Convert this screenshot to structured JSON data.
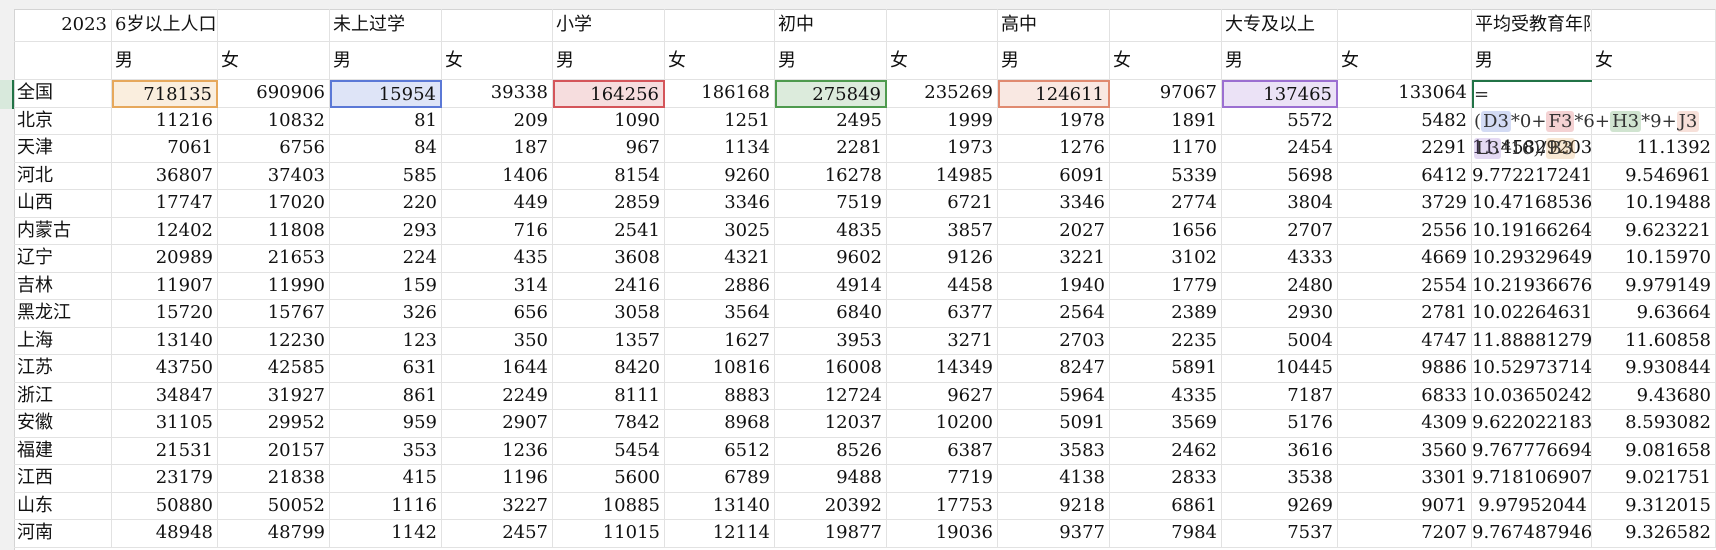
{
  "sheet": {
    "header_row": [
      "2023",
      "6岁以上人口",
      "",
      "未上过学",
      "",
      "小学",
      "",
      "初中",
      "",
      "高中",
      "",
      "大专及以上",
      "",
      "平均受教育年限",
      ""
    ],
    "sub_header": [
      "",
      "男",
      "女",
      "男",
      "女",
      "男",
      "女",
      "男",
      "女",
      "男",
      "女",
      "男",
      "女",
      "男",
      "女"
    ],
    "rows": [
      [
        "全国",
        "718135",
        "690906",
        "15954",
        "39338",
        "164256",
        "186168",
        "275849",
        "235269",
        "124611",
        "97067",
        "137465",
        "133064",
        "",
        ""
      ],
      [
        "北京",
        "11216",
        "10832",
        "81",
        "209",
        "1090",
        "1251",
        "2495",
        "1999",
        "1978",
        "1891",
        "5572",
        "5482",
        "",
        ""
      ],
      [
        "天津",
        "7061",
        "6756",
        "84",
        "187",
        "967",
        "1134",
        "2281",
        "1973",
        "1276",
        "1170",
        "2454",
        "2291",
        "11.45829203",
        "11.1392"
      ],
      [
        "河北",
        "36807",
        "37403",
        "585",
        "1406",
        "8154",
        "9260",
        "16278",
        "14985",
        "6091",
        "5339",
        "5698",
        "6412",
        "9.772217241",
        "9.546961"
      ],
      [
        "山西",
        "17747",
        "17020",
        "220",
        "449",
        "2859",
        "3346",
        "7519",
        "6721",
        "3346",
        "2774",
        "3804",
        "3729",
        "10.47168536",
        "10.19488"
      ],
      [
        "内蒙古",
        "12402",
        "11808",
        "293",
        "716",
        "2541",
        "3025",
        "4835",
        "3857",
        "2027",
        "1656",
        "2707",
        "2556",
        "10.19166264",
        "9.623221"
      ],
      [
        "辽宁",
        "20989",
        "21653",
        "224",
        "435",
        "3608",
        "4321",
        "9602",
        "9126",
        "3221",
        "3102",
        "4333",
        "4669",
        "10.29329649",
        "10.15970"
      ],
      [
        "吉林",
        "11907",
        "11990",
        "159",
        "314",
        "2416",
        "2886",
        "4914",
        "4458",
        "1940",
        "1779",
        "2480",
        "2554",
        "10.21936676",
        "9.979149"
      ],
      [
        "黑龙江",
        "15720",
        "15767",
        "326",
        "656",
        "3058",
        "3564",
        "6840",
        "6377",
        "2564",
        "2389",
        "2930",
        "2781",
        "10.02264631",
        "9.63664"
      ],
      [
        "上海",
        "13140",
        "12230",
        "123",
        "350",
        "1357",
        "1627",
        "3953",
        "3271",
        "2703",
        "2235",
        "5004",
        "4747",
        "11.88881279",
        "11.60858"
      ],
      [
        "江苏",
        "43750",
        "42585",
        "631",
        "1644",
        "8420",
        "10816",
        "16008",
        "14349",
        "8247",
        "5891",
        "10445",
        "9886",
        "10.52973714",
        "9.930844"
      ],
      [
        "浙江",
        "34847",
        "31927",
        "861",
        "2249",
        "8111",
        "8883",
        "12724",
        "9627",
        "5964",
        "4335",
        "7187",
        "6833",
        "10.03650242",
        "9.43680"
      ],
      [
        "安徽",
        "31105",
        "29952",
        "959",
        "2907",
        "7842",
        "8968",
        "12037",
        "10200",
        "5091",
        "3569",
        "5176",
        "4309",
        "9.622022183",
        "8.593082"
      ],
      [
        "福建",
        "21531",
        "20157",
        "353",
        "1236",
        "5454",
        "6512",
        "8526",
        "6387",
        "3583",
        "2462",
        "3616",
        "3560",
        "9.767776694",
        "9.081658"
      ],
      [
        "江西",
        "23179",
        "21838",
        "415",
        "1196",
        "5600",
        "6789",
        "9488",
        "7719",
        "4138",
        "2833",
        "3538",
        "3301",
        "9.718106907",
        "9.021751"
      ],
      [
        "山东",
        "50880",
        "50052",
        "1116",
        "3227",
        "10885",
        "13140",
        "20392",
        "17753",
        "9218",
        "6861",
        "9269",
        "9071",
        "9.97952044",
        "9.312015"
      ],
      [
        "河南",
        "48948",
        "48799",
        "1142",
        "2457",
        "11015",
        "12114",
        "19877",
        "19036",
        "9377",
        "7984",
        "7537",
        "7207",
        "9.767487946",
        "9.326582"
      ]
    ],
    "formula": {
      "line1": [
        "=(",
        "D3",
        "*0+",
        "F3",
        "*6+",
        "H3",
        "*9+",
        "J3"
      ],
      "line2": [
        "L3",
        "*16)",
        "/",
        "B3"
      ]
    },
    "colors": {
      "B3": "#e6a85c",
      "D3": "#5b78d6",
      "F3": "#d4555a",
      "H3": "#4e9a4e",
      "J3": "#e08a70",
      "L3": "#9b6fd1",
      "active": "#217346"
    }
  }
}
